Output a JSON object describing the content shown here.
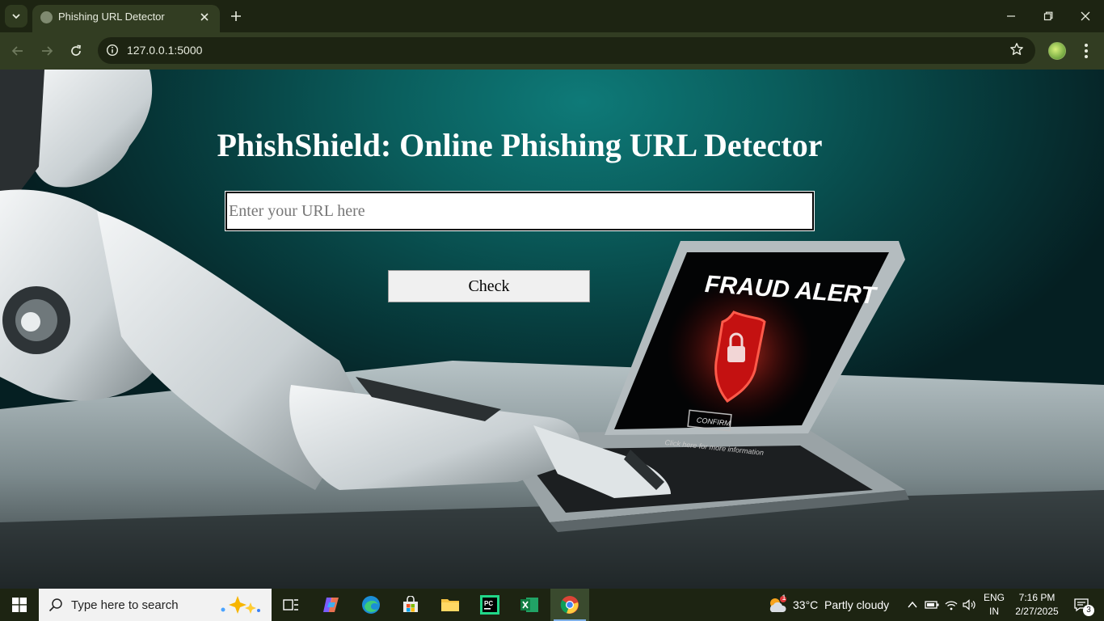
{
  "browser": {
    "tab_title": "Phishing URL Detector",
    "url": "127.0.0.1:5000"
  },
  "page": {
    "heading": "PhishShield: Online Phishing URL Detector",
    "url_input_placeholder": "Enter your URL here",
    "url_input_value": "",
    "check_button": "Check",
    "background_laptop_title": "FRAUD ALERT",
    "background_laptop_button": "CONFIRM",
    "background_laptop_note": "Click here for more information"
  },
  "taskbar": {
    "search_placeholder": "Type here to search",
    "weather_temp": "33°C",
    "weather_desc": "Partly cloudy",
    "weather_badge": "1",
    "lang": "ENG",
    "lang_region": "IN",
    "time": "7:16 PM",
    "date": "2/27/2025",
    "notifications": "3"
  },
  "colors": {
    "chrome_dark": "#1d2412",
    "chrome_toolbar": "#323d22",
    "page_teal": "#0a5d5c",
    "alert_red": "#d11a1a"
  }
}
